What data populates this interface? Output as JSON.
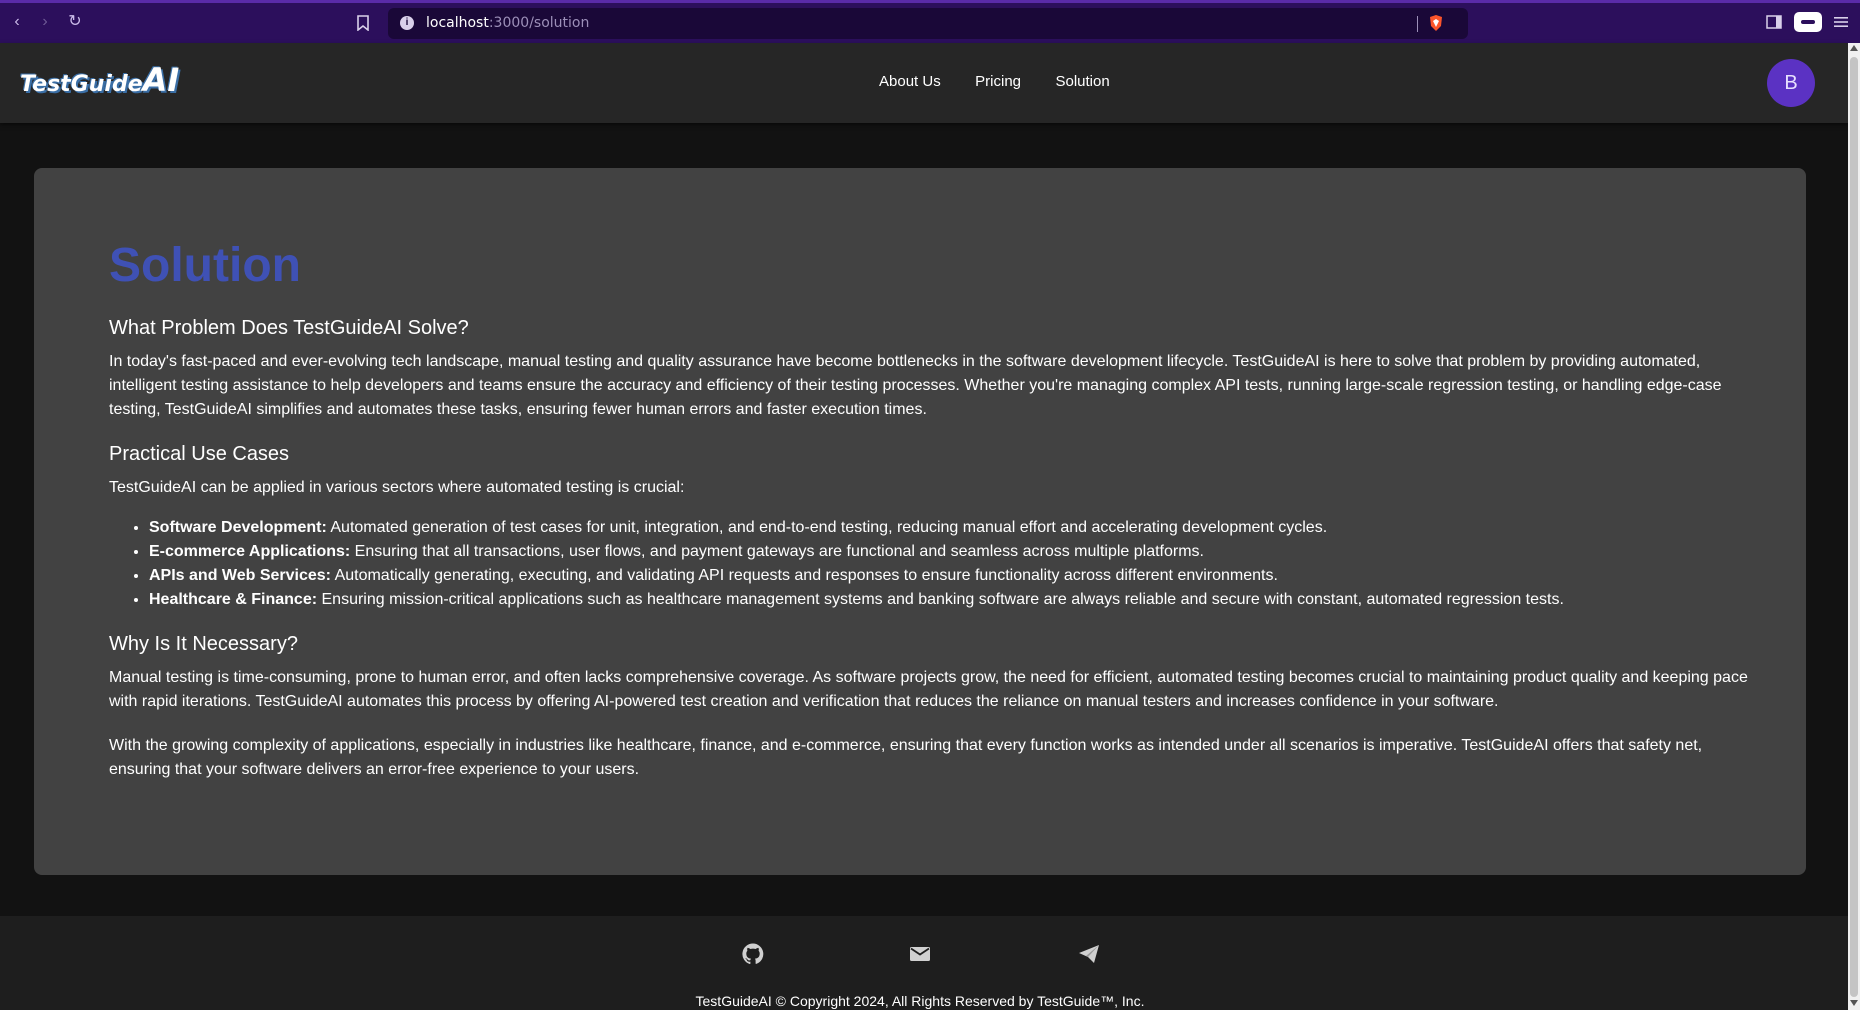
{
  "browser": {
    "url_host": "localhost",
    "url_path": ":3000/solution"
  },
  "header": {
    "logo_main": "TestGuide",
    "logo_ai": "AI",
    "nav": [
      "About Us",
      "Pricing",
      "Solution"
    ],
    "avatar_initial": "B"
  },
  "content": {
    "title": "Solution",
    "sections": {
      "problem": {
        "heading": "What Problem Does TestGuideAI Solve?",
        "text": "In today's fast-paced and ever-evolving tech landscape, manual testing and quality assurance have become bottlenecks in the software development lifecycle. TestGuideAI is here to solve that problem by providing automated, intelligent testing assistance to help developers and teams ensure the accuracy and efficiency of their testing processes. Whether you're managing complex API tests, running large-scale regression testing, or handling edge-case testing, TestGuideAI simplifies and automates these tasks, ensuring fewer human errors and faster execution times."
      },
      "uses": {
        "heading": "Practical Use Cases",
        "intro": "TestGuideAI can be applied in various sectors where automated testing is crucial:",
        "items": [
          {
            "label": "Software Development:",
            "text": " Automated generation of test cases for unit, integration, and end-to-end testing, reducing manual effort and accelerating development cycles."
          },
          {
            "label": "E-commerce Applications:",
            "text": " Ensuring that all transactions, user flows, and payment gateways are functional and seamless across multiple platforms."
          },
          {
            "label": "APIs and Web Services:",
            "text": " Automatically generating, executing, and validating API requests and responses to ensure functionality across different environments."
          },
          {
            "label": "Healthcare & Finance:",
            "text": " Ensuring mission-critical applications such as healthcare management systems and banking software are always reliable and secure with constant, automated regression tests."
          }
        ]
      },
      "necessary": {
        "heading": "Why Is It Necessary?",
        "text1": "Manual testing is time-consuming, prone to human error, and often lacks comprehensive coverage. As software projects grow, the need for efficient, automated testing becomes crucial to maintaining product quality and keeping pace with rapid iterations. TestGuideAI automates this process by offering AI-powered test creation and verification that reduces the reliance on manual testers and increases confidence in your software.",
        "text2": "With the growing complexity of applications, especially in industries like healthcare, finance, and e-commerce, ensuring that every function works as intended under all scenarios is imperative. TestGuideAI offers that safety net, ensuring that your software delivers an error-free experience to your users."
      }
    }
  },
  "footer": {
    "icons": [
      "github-icon",
      "mail-icon",
      "telegram-icon"
    ],
    "copyright": "TestGuideAI © Copyright 2024, All Rights Reserved by TestGuide™, Inc."
  },
  "colors": {
    "title": "#3f51b5",
    "avatar": "#5b32c3",
    "browser_bar": "#2c0f5c"
  }
}
